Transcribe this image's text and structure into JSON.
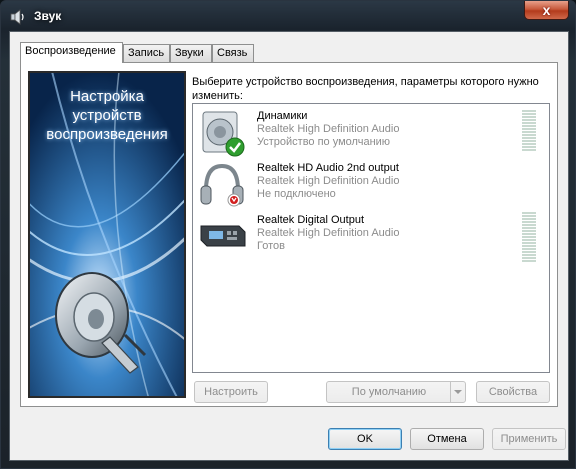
{
  "window": {
    "title": "Звук",
    "close_symbol": "x"
  },
  "tabs": [
    {
      "label": "Воспроизведение",
      "active": true
    },
    {
      "label": "Запись",
      "active": false
    },
    {
      "label": "Звуки",
      "active": false
    },
    {
      "label": "Связь",
      "active": false
    }
  ],
  "banner": {
    "line1": "Настройка",
    "line2": "устройств",
    "line3": "воспроизведения"
  },
  "instruction": "Выберите устройство воспроизведения, параметры которого нужно изменить:",
  "devices": [
    {
      "name": "Динамики",
      "driver": "Realtek High Definition Audio",
      "status": "Устройство по умолчанию",
      "icon": "speaker-icon",
      "badge": "default-check-icon",
      "level": 0.0
    },
    {
      "name": "Realtek HD Audio 2nd output",
      "driver": "Realtek High Definition Audio",
      "status": "Не подключено",
      "icon": "headphones-icon",
      "badge": "unplugged-icon",
      "level": null
    },
    {
      "name": "Realtek Digital Output",
      "driver": "Realtek High Definition Audio",
      "status": "Готов",
      "icon": "digital-output-icon",
      "badge": null,
      "level": 0.0
    }
  ],
  "panel_buttons": {
    "configure": "Настроить",
    "set_default": "По умолчанию",
    "properties": "Свойства"
  },
  "dialog_buttons": {
    "ok": "OK",
    "cancel": "Отмена",
    "apply": "Применить"
  },
  "colors": {
    "default_badge": "#2f9e2f",
    "unplugged_badge": "#d21f1f",
    "banner_bg": "#0b2d59"
  }
}
